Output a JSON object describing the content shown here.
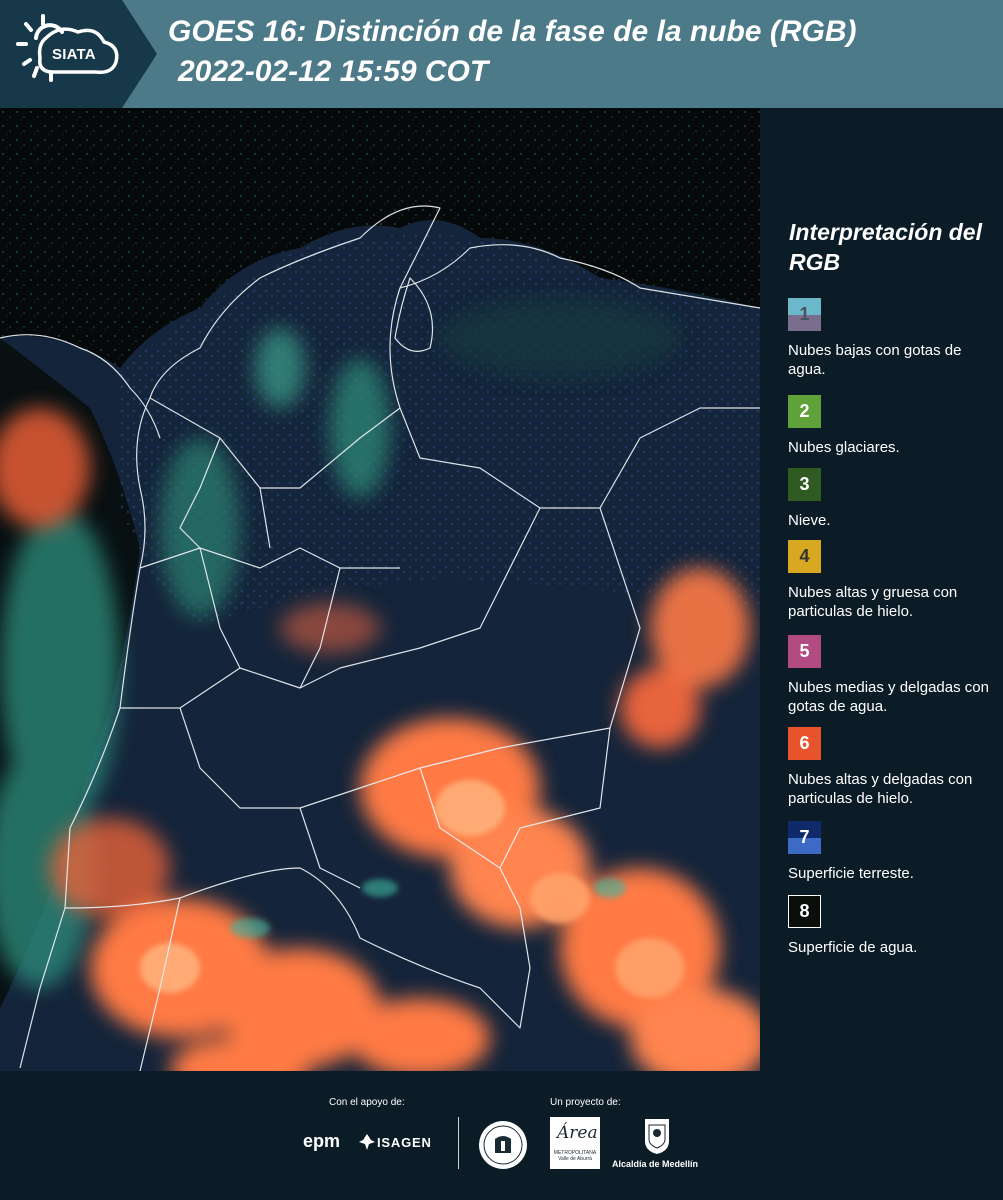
{
  "header": {
    "title": "GOES 16: Distinción de la fase de la nube (RGB)",
    "subtitle": "2022-02-12 15:59 COT",
    "logo_text": "SIATA",
    "bg_color": "#4d7a89",
    "logo_bg_color": "#173848"
  },
  "legend": {
    "title": "Interpretación del RGB",
    "items": [
      {
        "number": "1",
        "label": "Nubes bajas con gotas de agua.",
        "color_top": "#6ab8c9",
        "color_bottom": "#7a6e8e",
        "num_color": "#4e4e5c"
      },
      {
        "number": "2",
        "label": "Nubes glaciares.",
        "color_top": "#5fa23a",
        "color_bottom": "#5fa23a",
        "num_color": "#ffffff"
      },
      {
        "number": "3",
        "label": "Nieve.",
        "color_top": "#2f5b22",
        "color_bottom": "#2f5b22",
        "num_color": "#ffffff"
      },
      {
        "number": "4",
        "label": "Nubes altas y gruesa con particulas de hielo.",
        "color_top": "#d8a821",
        "color_bottom": "#d8a821",
        "num_color": "#333333"
      },
      {
        "number": "5",
        "label": "Nubes medias y delgadas con gotas de agua.",
        "color_top": "#b24b82",
        "color_bottom": "#b24b82",
        "num_color": "#ffffff"
      },
      {
        "number": "6",
        "label": "Nubes altas y delgadas con particulas de hielo.",
        "color_top": "#e8532c",
        "color_bottom": "#e8532c",
        "num_color": "#ffffff"
      },
      {
        "number": "7",
        "label": "Superficie terreste.",
        "color_top": "#0f2a6a",
        "color_bottom": "#3e6ac7",
        "num_color": "#ffffff"
      },
      {
        "number": "8",
        "label": "Superficie de agua.",
        "color_top": "#0a0f0c",
        "color_bottom": "#0a0f0c",
        "num_color": "#ffffff"
      }
    ]
  },
  "footer": {
    "support_label": "Con el apoyo de:",
    "project_label": "Un proyecto de:",
    "sponsors": {
      "epm": "epm",
      "isagen": "ISAGEN",
      "amva_big": "Área",
      "amva_small": "METROPOLITANA Valle de Aburrá",
      "medellin": "Alcaldía de Medellín"
    }
  },
  "map": {
    "description_colors": {
      "ocean": "#06090a",
      "land": "#14243a",
      "ice_cloud": "#ff7a45",
      "water_cloud": "#3fb7a0",
      "border": "#e8eef2"
    }
  }
}
